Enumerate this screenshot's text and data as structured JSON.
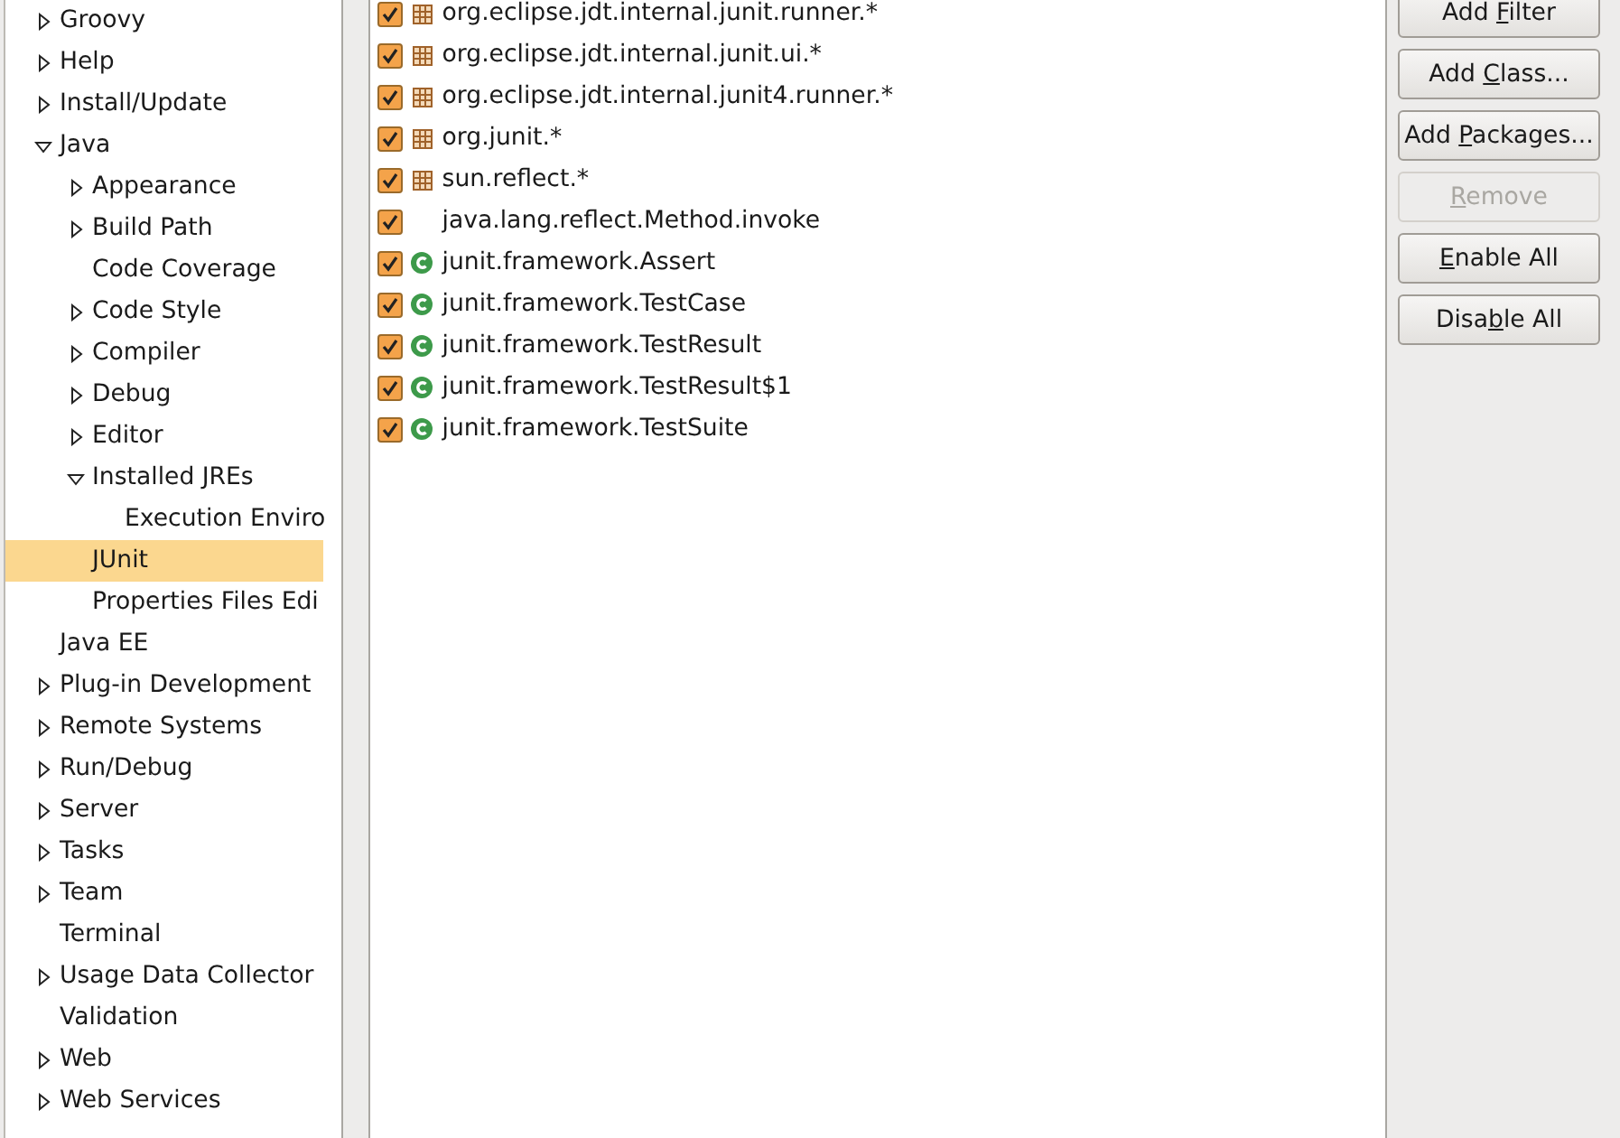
{
  "sidebar": {
    "items": [
      {
        "label": "Groovy",
        "expanded": false,
        "selected": false
      },
      {
        "label": "Help",
        "expanded": false,
        "selected": false
      },
      {
        "label": "Install/Update",
        "expanded": false,
        "selected": false
      },
      {
        "label": "Java",
        "expanded": true,
        "selected": false,
        "children": [
          {
            "label": "Appearance",
            "expanded": false,
            "selected": false
          },
          {
            "label": "Build Path",
            "expanded": false,
            "selected": false
          },
          {
            "label": "Code Coverage",
            "selected": false
          },
          {
            "label": "Code Style",
            "expanded": false,
            "selected": false
          },
          {
            "label": "Compiler",
            "expanded": false,
            "selected": false
          },
          {
            "label": "Debug",
            "expanded": false,
            "selected": false
          },
          {
            "label": "Editor",
            "expanded": false,
            "selected": false
          },
          {
            "label": "Installed JREs",
            "expanded": true,
            "selected": false,
            "children": [
              {
                "label": "Execution Enviro",
                "selected": false
              }
            ]
          },
          {
            "label": "JUnit",
            "selected": true
          },
          {
            "label": "Properties Files Edi",
            "selected": false
          }
        ]
      },
      {
        "label": "Java EE",
        "selected": false
      },
      {
        "label": "Plug-in Development",
        "expanded": false,
        "selected": false
      },
      {
        "label": "Remote Systems",
        "expanded": false,
        "selected": false
      },
      {
        "label": "Run/Debug",
        "expanded": false,
        "selected": false
      },
      {
        "label": "Server",
        "expanded": false,
        "selected": false
      },
      {
        "label": "Tasks",
        "expanded": false,
        "selected": false
      },
      {
        "label": "Team",
        "expanded": false,
        "selected": false
      },
      {
        "label": "Terminal",
        "selected": false
      },
      {
        "label": "Usage Data Collector",
        "expanded": false,
        "selected": false
      },
      {
        "label": "Validation",
        "selected": false
      },
      {
        "label": "Web",
        "expanded": false,
        "selected": false
      },
      {
        "label": "Web Services",
        "expanded": false,
        "selected": false
      }
    ]
  },
  "filters": [
    {
      "kind": "package",
      "label": "org.eclipse.jdt.internal.junit.runner.*",
      "checked": true
    },
    {
      "kind": "package",
      "label": "org.eclipse.jdt.internal.junit.ui.*",
      "checked": true
    },
    {
      "kind": "package",
      "label": "org.eclipse.jdt.internal.junit4.runner.*",
      "checked": true
    },
    {
      "kind": "package",
      "label": "org.junit.*",
      "checked": true
    },
    {
      "kind": "package",
      "label": "sun.reflect.*",
      "checked": true
    },
    {
      "kind": "method",
      "label": "java.lang.reflect.Method.invoke",
      "checked": true
    },
    {
      "kind": "class",
      "label": "junit.framework.Assert",
      "checked": true
    },
    {
      "kind": "class",
      "label": "junit.framework.TestCase",
      "checked": true
    },
    {
      "kind": "class",
      "label": "junit.framework.TestResult",
      "checked": true
    },
    {
      "kind": "class",
      "label": "junit.framework.TestResult$1",
      "checked": true
    },
    {
      "kind": "class",
      "label": "junit.framework.TestSuite",
      "checked": true
    }
  ],
  "buttons": [
    {
      "before": "Add ",
      "key": "F",
      "after": "ilter",
      "disabled": false
    },
    {
      "before": "Add ",
      "key": "C",
      "after": "lass...",
      "disabled": false
    },
    {
      "before": "Add ",
      "key": "P",
      "after": "ackages...",
      "disabled": false
    },
    {
      "key": "R",
      "after": "emove",
      "disabled": true
    },
    {
      "key": "E",
      "after": "nable All",
      "disabled": false
    },
    {
      "before": "Disa",
      "key": "b",
      "after": "le All",
      "disabled": false
    }
  ]
}
